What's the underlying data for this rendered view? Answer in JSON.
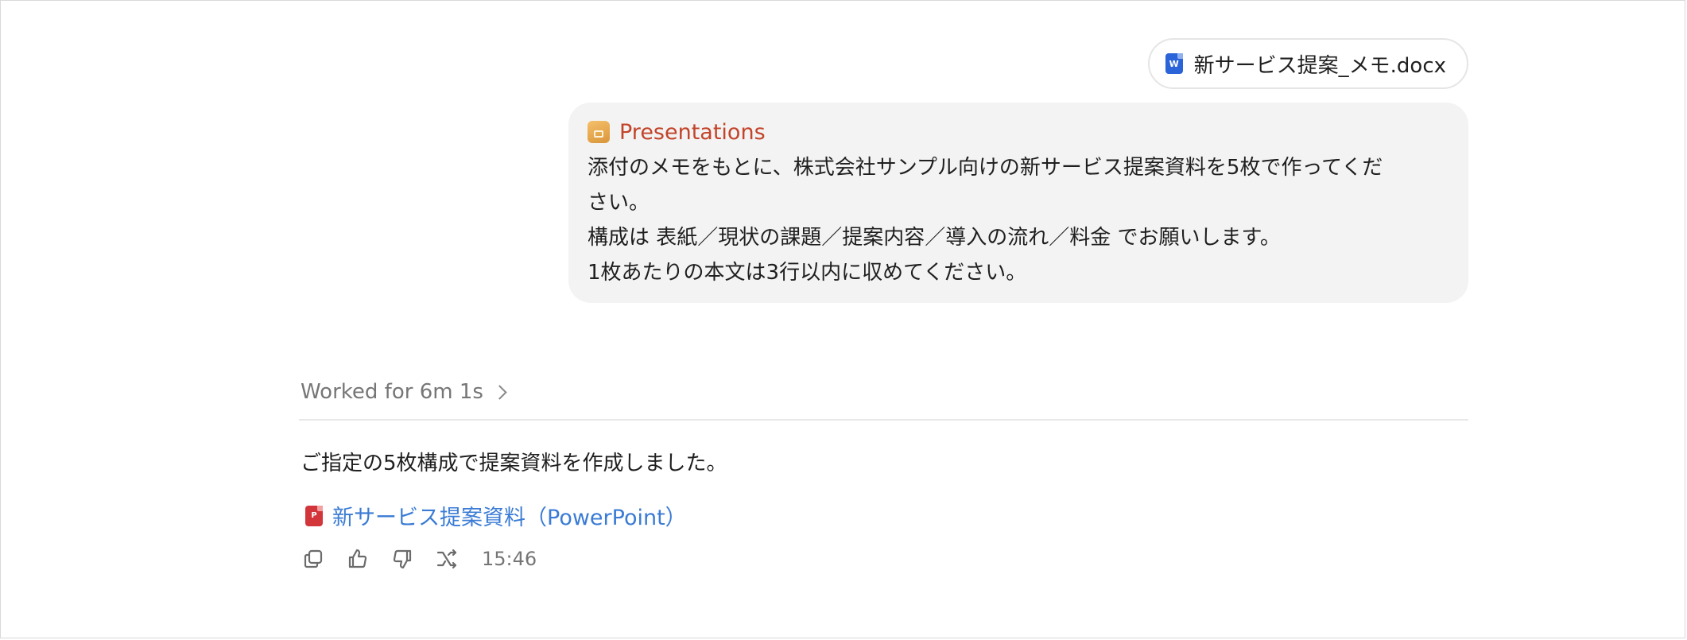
{
  "attachment": {
    "filename": "新サービス提案_メモ.docx",
    "icon": "word-doc-icon"
  },
  "user_message": {
    "tool_label": "Presentations",
    "tool_icon": "presentations-icon",
    "lines": [
      "添付のメモをもとに、株式会社サンプル向けの新サービス提案資料を5枚で作ってくだ",
      "さい。",
      "構成は 表紙／現状の課題／提案内容／導入の流れ／料金 でお願いします。",
      "1枚あたりの本文は3行以内に収めてください。"
    ]
  },
  "assistant": {
    "worked_label": "Worked for 6m 1s",
    "reply": "ご指定の5枚構成で提案資料を作成しました。",
    "file_link": "新サービス提案資料（PowerPoint）",
    "file_icon": "powerpoint-icon",
    "doc_icon_letter": "W",
    "ppt_icon_letter": "P",
    "timestamp": "15:46",
    "actions": [
      "copy-icon",
      "thumbs-up-icon",
      "thumbs-down-icon",
      "share-icon"
    ]
  },
  "colors": {
    "tool_label": "#c2442a",
    "link": "#3a7bd5",
    "bubble_bg": "#f3f3f3",
    "muted": "#767676"
  }
}
